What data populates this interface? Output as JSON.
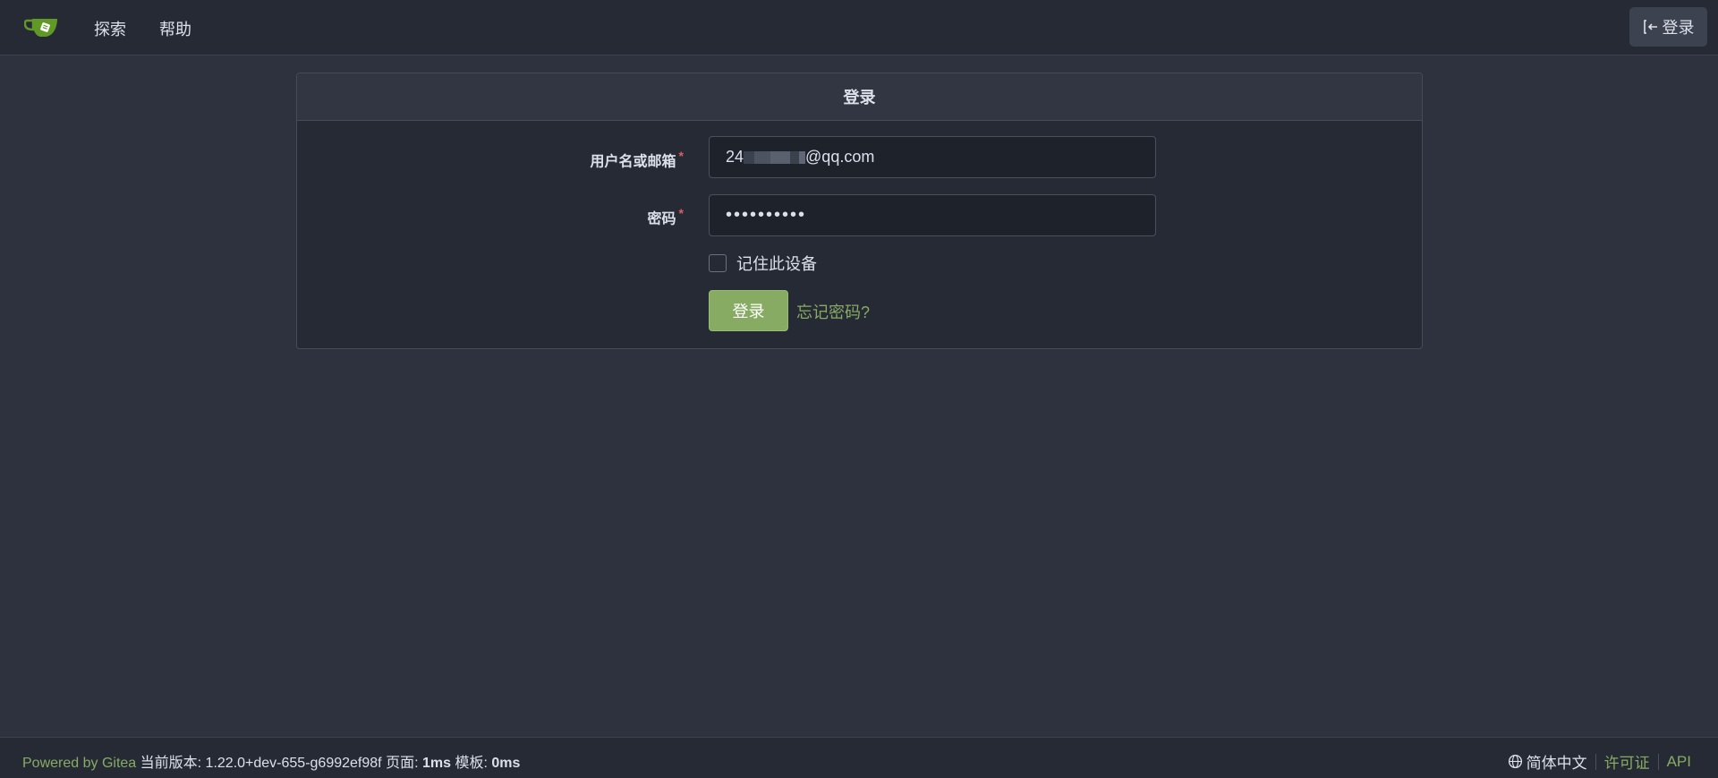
{
  "navbar": {
    "logo_icon": "gitea-teacup-icon",
    "items": [
      {
        "label": "探索"
      },
      {
        "label": "帮助"
      }
    ],
    "signin_label": "登录",
    "signin_icon": "sign-in-icon"
  },
  "login_card": {
    "title": "登录",
    "username_label": "用户名或邮箱",
    "username_value_prefix": "24",
    "username_value_suffix": "@qq.com",
    "password_label": "密码",
    "password_value": "••••••••••",
    "required_marker": "*",
    "remember_label": "记住此设备",
    "remember_checked": false,
    "submit_label": "登录",
    "forgot_label": "忘记密码?"
  },
  "footer": {
    "powered_by": "Powered by Gitea",
    "version_label": "当前版本:",
    "version_value": "1.22.0+dev-655-g6992ef98f",
    "page_label": "页面:",
    "page_time": "1ms",
    "template_label": "模板:",
    "template_time": "0ms",
    "language": "简体中文",
    "language_icon": "globe-icon",
    "license_label": "许可证",
    "api_label": "API"
  },
  "colors": {
    "background": "#2e323e",
    "navbar": "#262a35",
    "accent_green": "#87ab63",
    "required_red": "#e05d5d"
  }
}
